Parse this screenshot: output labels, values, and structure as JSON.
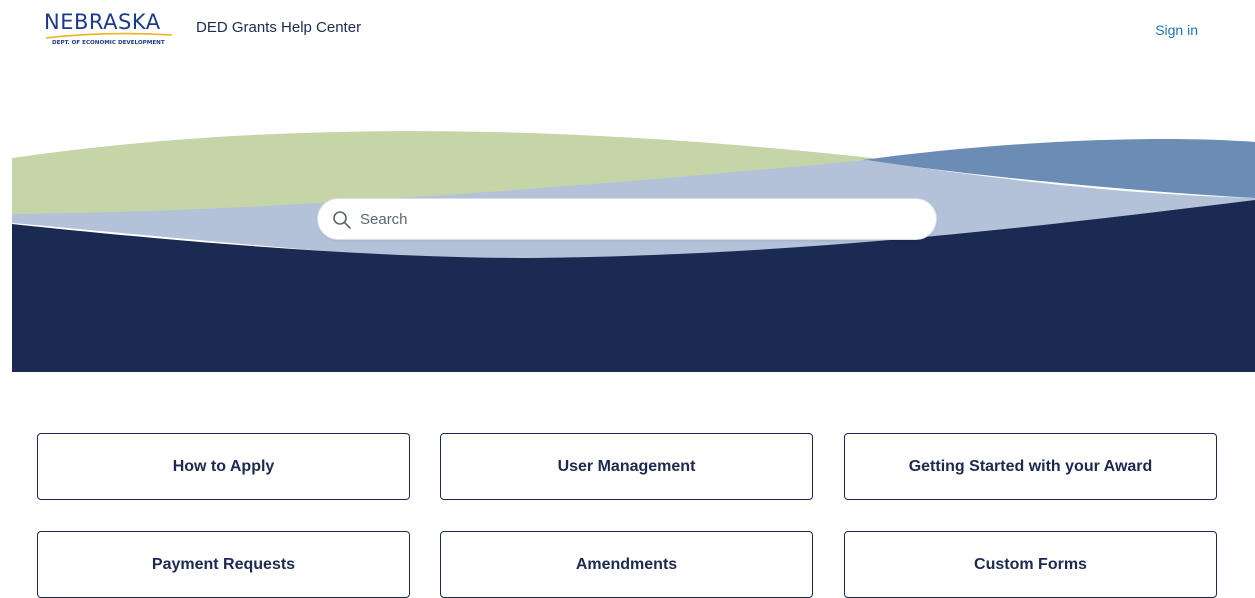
{
  "header": {
    "logo_word": "NEBRASKA",
    "logo_subtitle": "DEPT. OF ECONOMIC DEVELOPMENT",
    "site_title": "DED Grants Help Center",
    "sign_in_label": "Sign in"
  },
  "search": {
    "placeholder": "Search",
    "value": ""
  },
  "categories": [
    {
      "label": "How to Apply"
    },
    {
      "label": "User Management"
    },
    {
      "label": "Getting Started with your Award"
    },
    {
      "label": "Payment Requests"
    },
    {
      "label": "Amendments"
    },
    {
      "label": "Custom Forms"
    }
  ],
  "colors": {
    "navy": "#1a2a52",
    "light_green": "#c5d5a8",
    "light_blue": "#b3c2d9",
    "steel_blue": "#6b8db5",
    "logo_blue": "#1a3a8a",
    "logo_gold": "#e7b422",
    "link_blue": "#1f73b7"
  },
  "icons": {
    "search": "search-icon"
  }
}
